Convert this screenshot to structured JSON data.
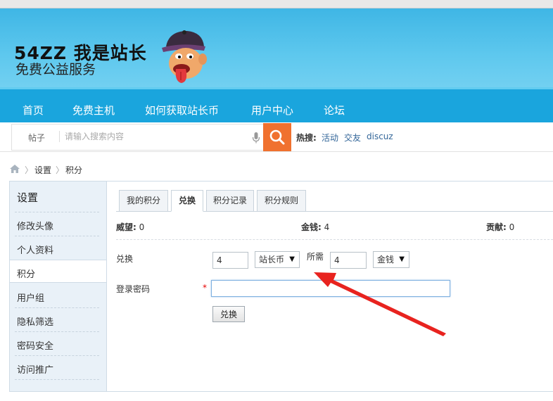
{
  "header": {
    "logo_main": "54ZZ 我是站长",
    "logo_sub": "免费公益服务"
  },
  "nav": {
    "items": [
      "首页",
      "免费主机",
      "如何获取站长币",
      "用户中心",
      "论坛"
    ]
  },
  "search": {
    "type_label": "帖子",
    "placeholder": "请输入搜索内容",
    "hot_label": "热搜:",
    "hot_links": [
      "活动",
      "交友",
      "discuz"
    ]
  },
  "breadcrumb": {
    "items": [
      "设置",
      "积分"
    ]
  },
  "sidebar": {
    "title": "设置",
    "items": [
      "修改头像",
      "个人资料",
      "积分",
      "用户组",
      "隐私筛选",
      "密码安全",
      "访问推广"
    ],
    "active_index": 2
  },
  "tabs": {
    "items": [
      "我的积分",
      "兑换",
      "积分记录",
      "积分规则"
    ],
    "active_index": 1
  },
  "stats": {
    "prestige_label": "威望:",
    "prestige_value": "0",
    "money_label": "金钱:",
    "money_value": "4",
    "contrib_label": "贡献:",
    "contrib_value": "0"
  },
  "form": {
    "exchange_label": "兑换",
    "exchange_amount": "4",
    "exchange_currency": "站长币",
    "required_label": "所需",
    "required_amount": "4",
    "required_currency": "金钱",
    "password_label": "登录密码",
    "required_mark": "*",
    "submit_label": "兑换"
  },
  "colors": {
    "hero": "#56c4ea",
    "nav": "#1aa5dd",
    "search_button": "#f0712f",
    "arrow": "#e8231f"
  }
}
